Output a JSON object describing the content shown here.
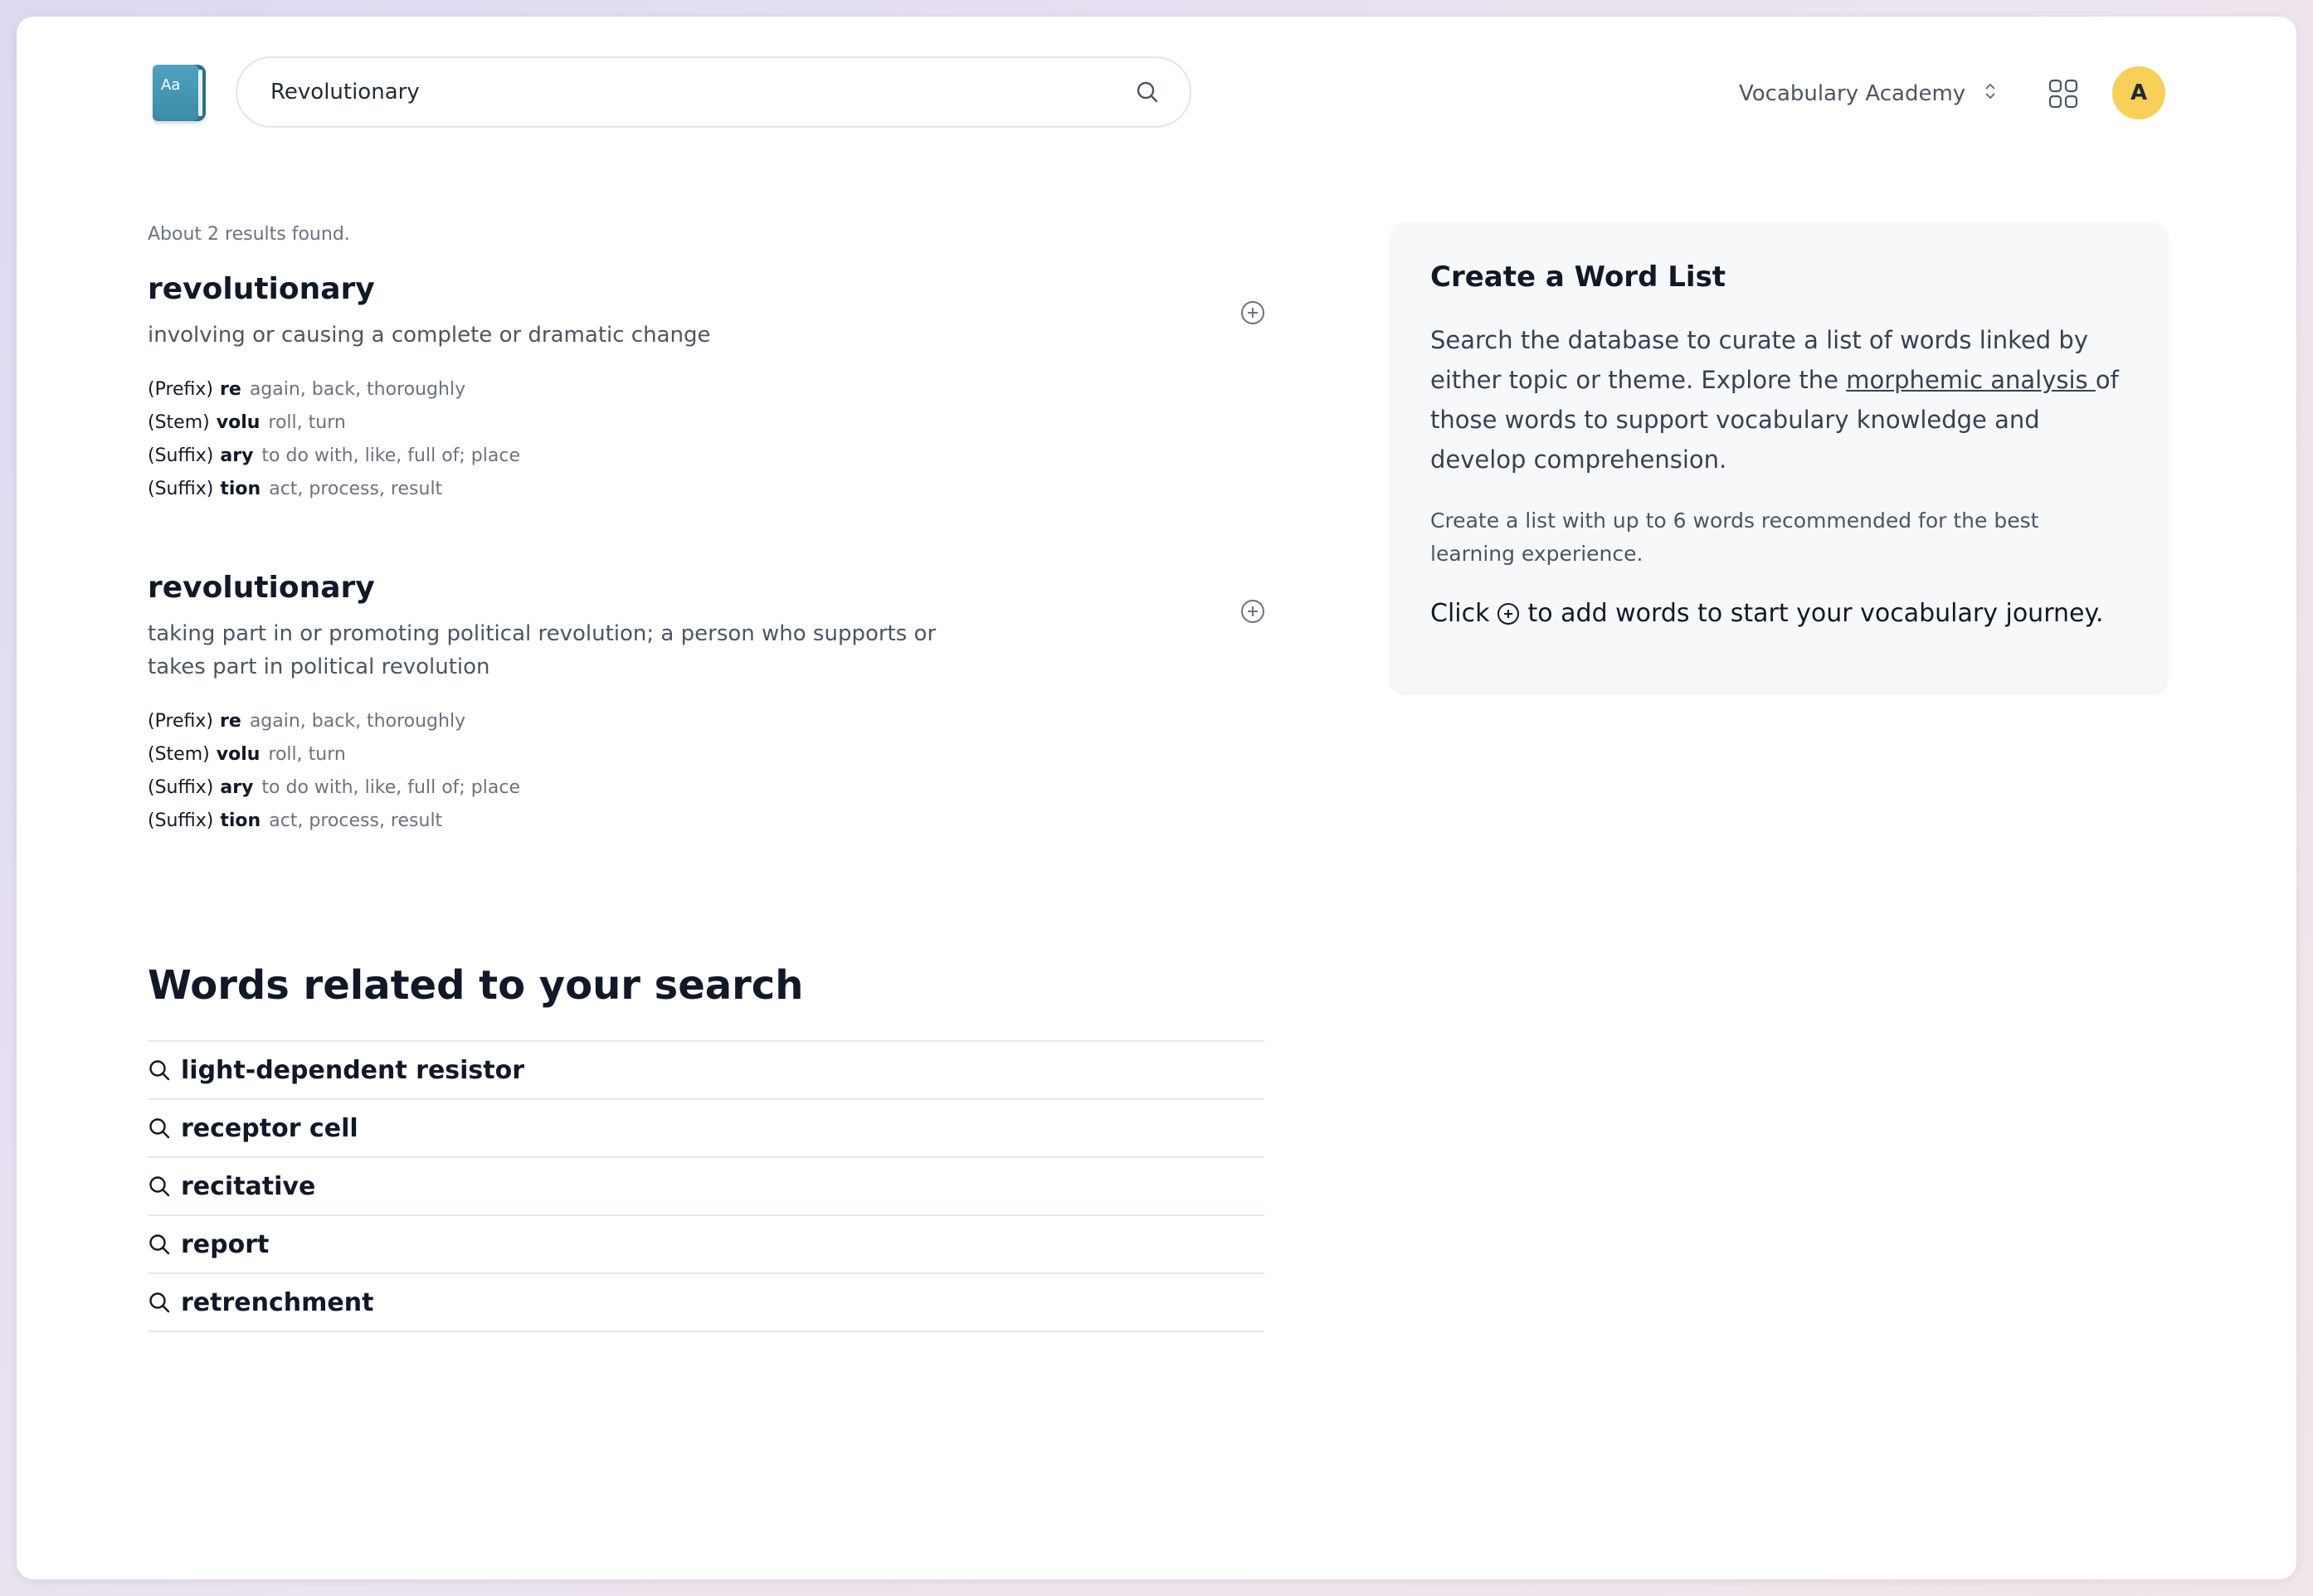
{
  "header": {
    "logo_text": "Aa",
    "search_value": "Revolutionary",
    "org_name": "Vocabulary Academy",
    "avatar_initial": "A"
  },
  "results": {
    "count_text": "About 2 results found.",
    "items": [
      {
        "word": "revolutionary",
        "definition": "involving or causing a complete or dramatic change",
        "parts": [
          {
            "type": "(Prefix)",
            "morpheme": "re",
            "meaning": "again, back, thoroughly"
          },
          {
            "type": "(Stem)",
            "morpheme": "volu",
            "meaning": "roll, turn"
          },
          {
            "type": "(Suffix)",
            "morpheme": "ary",
            "meaning": "to do with, like, full of; place"
          },
          {
            "type": "(Suffix)",
            "morpheme": "tion",
            "meaning": "act, process, result"
          }
        ]
      },
      {
        "word": "revolutionary",
        "definition": "taking part in or promoting political revolution; a person who supports or takes part in political revolution",
        "parts": [
          {
            "type": "(Prefix)",
            "morpheme": "re",
            "meaning": "again, back, thoroughly"
          },
          {
            "type": "(Stem)",
            "morpheme": "volu",
            "meaning": "roll, turn"
          },
          {
            "type": "(Suffix)",
            "morpheme": "ary",
            "meaning": "to do with, like, full of; place"
          },
          {
            "type": "(Suffix)",
            "morpheme": "tion",
            "meaning": "act, process, result"
          }
        ]
      }
    ]
  },
  "related": {
    "title": "Words related to your search",
    "items": [
      "light-dependent resistor",
      "receptor cell",
      "recitative",
      "report",
      "retrenchment"
    ]
  },
  "card": {
    "title": "Create a Word List",
    "body_before": "Search the database to curate a list of words linked by either topic or theme. Explore the ",
    "body_link": "morphemic analysis ",
    "body_after": "of those words to support vocabulary knowledge and develop comprehension.",
    "note": "Create a list with up to 6 words recommended for the best learning experience.",
    "cta_before": "Click",
    "cta_after": "to add words to start your vocabulary journey."
  },
  "colors": {
    "accent_logo": "#4fa3c0",
    "avatar_bg": "#f8cf58",
    "card_bg": "#f7f8fa"
  }
}
